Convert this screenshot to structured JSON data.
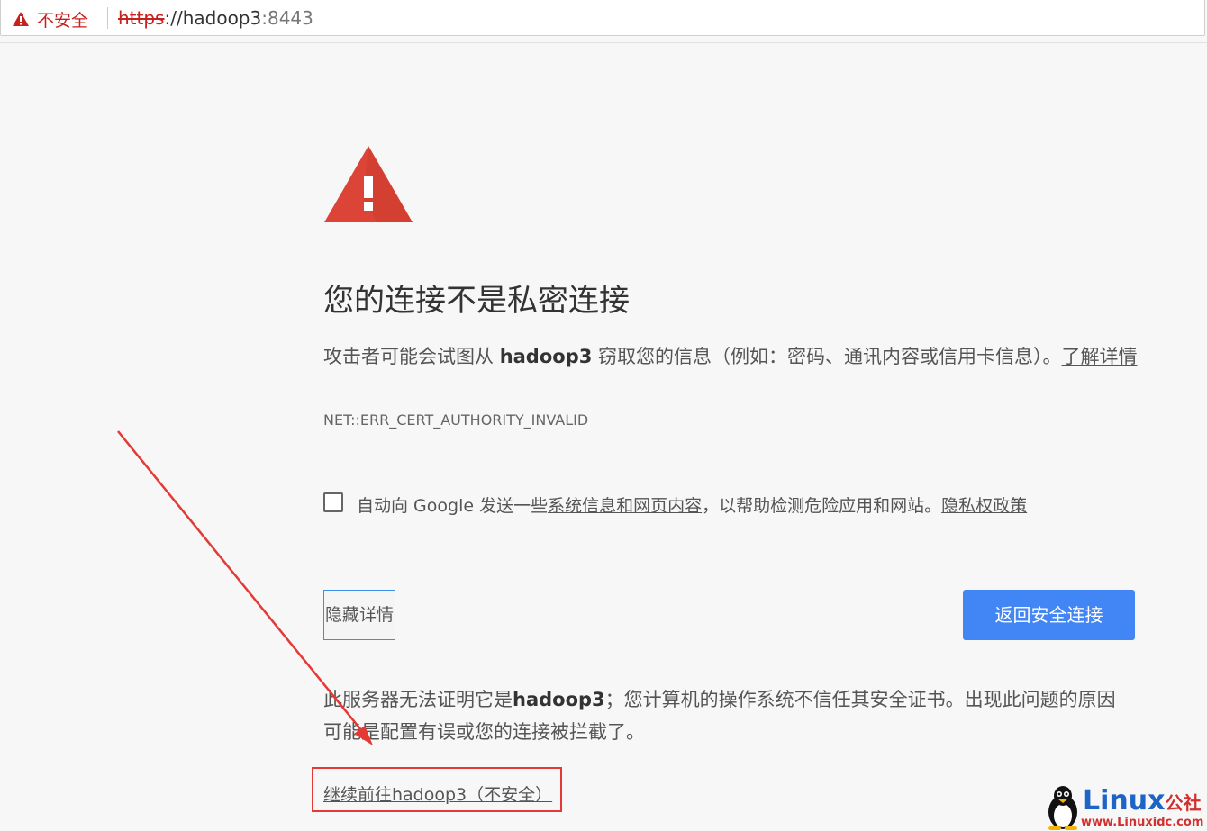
{
  "address_bar": {
    "security_label": "不安全",
    "url_scheme": "https",
    "url_separator": "://",
    "url_host": "hadoop3",
    "url_port": ":8443"
  },
  "interstitial": {
    "heading": "您的连接不是私密连接",
    "explain_prefix": "攻击者可能会试图从 ",
    "explain_host": "hadoop3",
    "explain_suffix": " 窃取您的信息（例如：密码、通讯内容或信用卡信息）。",
    "learn_more": "了解详情",
    "error_code": "NET::ERR_CERT_AUTHORITY_INVALID",
    "checkbox_prefix": "自动向 Google 发送一些",
    "checkbox_link": "系统信息和网页内容",
    "checkbox_middle": "，以帮助检测危险应用和网站。",
    "privacy_link": "隐私权政策",
    "hide_details_button": "隐藏详情",
    "back_button": "返回安全连接",
    "details_prefix": "此服务器无法证明它是",
    "details_host": "hadoop3",
    "details_suffix": "；您计算机的操作系统不信任其安全证书。出现此问题的原因可能是配置有误或您的连接被拦截了。",
    "proceed_link": "继续前往hadoop3（不安全）"
  },
  "watermark": {
    "brand": "Linux",
    "brand_cn": "公社",
    "url": "www.Linuxidc.com"
  },
  "colors": {
    "warning_red": "#db4437",
    "button_blue": "#4285f4",
    "annotation_red": "#e53935"
  }
}
